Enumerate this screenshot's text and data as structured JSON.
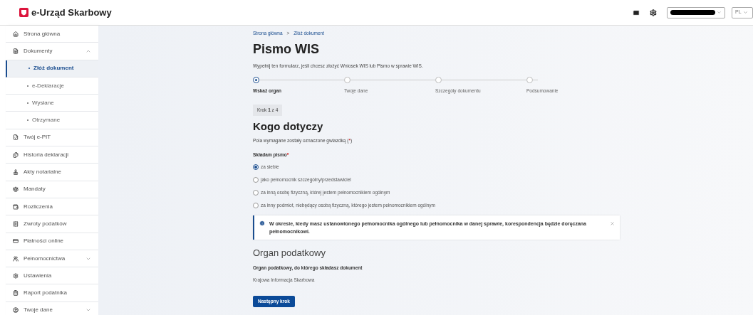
{
  "header": {
    "logo_text": "e-Urząd Skarbowy",
    "account_redacted": true,
    "language": "PL"
  },
  "sidebar": {
    "items": [
      {
        "label": "Strona główna",
        "selected": false
      },
      {
        "label": "Dokumenty",
        "selected": false,
        "expanded": true,
        "children": [
          {
            "label": "Złóż dokument",
            "selected": true
          },
          {
            "label": "e-Deklaracje",
            "selected": false
          },
          {
            "label": "Wysłane",
            "selected": false
          },
          {
            "label": "Otrzymane",
            "selected": false
          }
        ]
      },
      {
        "label": "Twój e-PIT",
        "selected": false
      },
      {
        "label": "Historia deklaracji",
        "selected": false
      },
      {
        "label": "Akty notarialne",
        "selected": false
      },
      {
        "label": "Mandaty",
        "selected": false
      },
      {
        "label": "Rozliczenia",
        "selected": false
      },
      {
        "label": "Zwroty podatków",
        "selected": false
      },
      {
        "label": "Płatności online",
        "selected": false
      },
      {
        "label": "Pełnomocnictwa",
        "selected": false,
        "expanded": false
      },
      {
        "label": "Ustawienia",
        "selected": false
      },
      {
        "label": "Raport podatnika",
        "selected": false
      },
      {
        "label": "Twoje dane",
        "selected": false,
        "expanded": false
      }
    ]
  },
  "breadcrumb": {
    "items": [
      "Strona główna",
      "Złóż dokument"
    ],
    "separator": ">"
  },
  "title": "Pismo WIS",
  "intro": "Wypełnij ten formularz, jeśli chcesz złożyć Wniosek WIS lub Pismo w sprawie WIS.",
  "steps": [
    {
      "label": "Wskaż organ",
      "selected": true
    },
    {
      "label": "Twoje dane",
      "selected": false
    },
    {
      "label": "Szczegóły dokumentu",
      "selected": false
    },
    {
      "label": "Podsumowanie",
      "selected": false
    }
  ],
  "step_badge": "Krok **1** z 4",
  "section": {
    "heading": "Kogo dotyczy",
    "note": "Pola wymagane zostały oznaczone gwiazdką (",
    "note_mark": "*",
    "note_end": ")"
  },
  "field": {
    "label": "Składam pismo",
    "required_mark": "*",
    "options": [
      {
        "label": "za siebie",
        "selected": true
      },
      {
        "label": "jako pełnomocnik szczególny/przedstawiciel",
        "selected": false
      },
      {
        "label": "za inną osobę fizyczną, której jestem pełnomocnikiem ogólnym",
        "selected": false
      },
      {
        "label": "za inny podmiot, niebędący osobą fizyczną, którego jestem pełnomocnikiem ogólnym",
        "selected": false
      }
    ]
  },
  "alert": {
    "text": "W okresie, kiedy masz ustanowionego pełnomocnika ogólnego lub pełnomocnika w danej sprawie, korespondencja będzie doręczana pełnomocnikowi.",
    "dismissible": true
  },
  "organ": {
    "heading": "Organ podatkowy",
    "label": "Organ podatkowy, do którego składasz dokument",
    "value": "Krajowa Informacja Skarbowa"
  },
  "next_button": "Następny krok"
}
